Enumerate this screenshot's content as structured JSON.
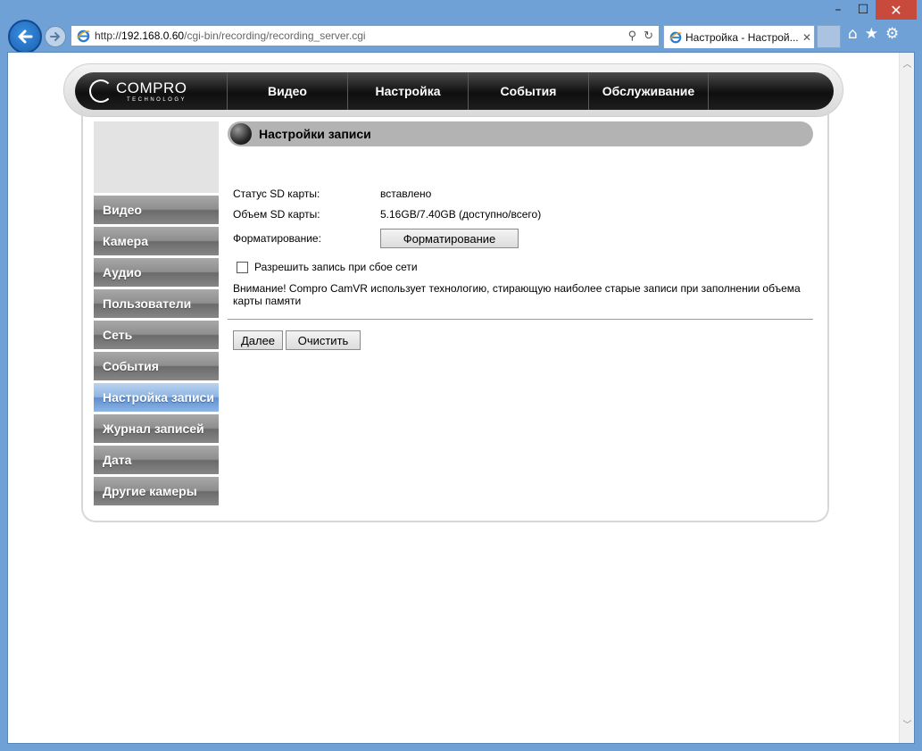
{
  "browser": {
    "url_prefix": "http://",
    "url_host": "192.168.0.60",
    "url_path": "/cgi-bin/recording/recording_server.cgi",
    "tab_title": "Настройка - Настрой...",
    "tab_close": "✕",
    "win_min": "–",
    "win_max": "☐",
    "win_close": "✕",
    "search_icon": "⚲",
    "refresh_icon": "↻",
    "home_icon": "⌂",
    "fav_icon": "★",
    "settings_icon": "⚙"
  },
  "logo": {
    "name": "COMPRO",
    "sub": "TECHNOLOGY"
  },
  "topnav": [
    "Видео",
    "Настройка",
    "События",
    "Обслуживание"
  ],
  "sidebar": [
    {
      "label": "Видео",
      "active": false
    },
    {
      "label": "Камера",
      "active": false
    },
    {
      "label": "Аудио",
      "active": false
    },
    {
      "label": "Пользователи",
      "active": false
    },
    {
      "label": "Сеть",
      "active": false
    },
    {
      "label": "События",
      "active": false
    },
    {
      "label": "Настройка записи",
      "active": true
    },
    {
      "label": "Журнал записей",
      "active": false
    },
    {
      "label": "Дата",
      "active": false
    },
    {
      "label": "Другие камеры",
      "active": false
    }
  ],
  "section": {
    "title": "Настройки записи",
    "sd_status_label": "Статус SD карты:",
    "sd_status_value": "вставлено",
    "sd_size_label": "Объем SD карты:",
    "sd_size_value": "5.16GB/7.40GB (доступно/всего)",
    "format_label": "Форматирование:",
    "format_button": "Форматирование",
    "network_fail_checkbox": "Разрешить запись при сбое сети",
    "network_fail_checked": false,
    "warning": "Внимание! Compro CamVR использует технологию, стирающую наиболее старые записи при заполнении объема карты памяти",
    "next_button": "Далее",
    "clear_button": "Очистить"
  }
}
